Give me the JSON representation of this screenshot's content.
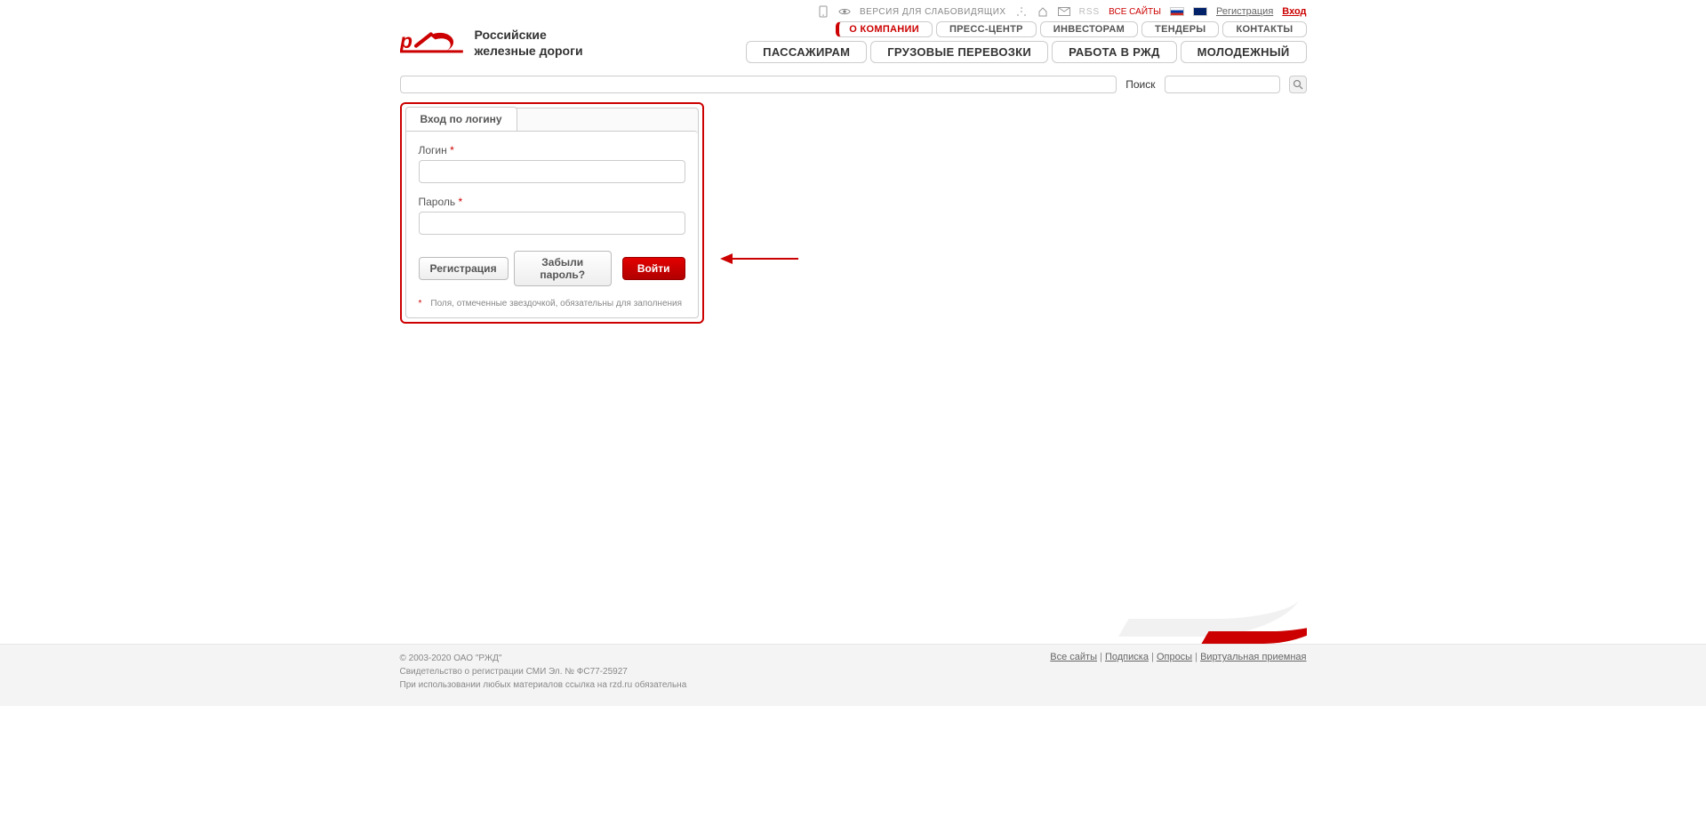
{
  "topbar": {
    "accessibility": "ВЕРСИЯ ДЛЯ СЛАБОВИДЯЩИХ",
    "rss": "RSS",
    "all_sites": "ВСЕ САЙТЫ",
    "register": "Регистрация",
    "login": "Вход"
  },
  "logo": {
    "line1": "Российские",
    "line2": "железные дороги"
  },
  "nav_primary": [
    {
      "label": "О КОМПАНИИ",
      "active": true
    },
    {
      "label": "ПРЕСС-ЦЕНТР",
      "active": false
    },
    {
      "label": "ИНВЕСТОРАМ",
      "active": false
    },
    {
      "label": "ТЕНДЕРЫ",
      "active": false
    },
    {
      "label": "КОНТАКТЫ",
      "active": false
    }
  ],
  "nav_secondary": [
    {
      "label": "ПАССАЖИРАМ"
    },
    {
      "label": "ГРУЗОВЫЕ ПЕРЕВОЗКИ"
    },
    {
      "label": "РАБОТА В РЖД"
    },
    {
      "label": "МОЛОДЕЖНЫЙ"
    }
  ],
  "search": {
    "label": "Поиск"
  },
  "login_form": {
    "tab": "Вход по логину",
    "login_label": "Логин",
    "password_label": "Пароль",
    "register_btn": "Регистрация",
    "forgot_btn": "Забыли пароль?",
    "submit_btn": "Войти",
    "note": "Поля, отмеченные звездочкой, обязательны для заполнения",
    "asterisk": "*"
  },
  "footer": {
    "copyright": "© 2003-2020 ОАО \"РЖД\"",
    "cert": "Свидетельство о регистрации СМИ Эл. № ФС77-25927",
    "usage": "При использовании любых материалов ссылка на rzd.ru обязательна",
    "links": {
      "all_sites": "Все сайты",
      "subscribe": "Подписка",
      "polls": "Опросы",
      "reception": "Виртуальная приемная"
    }
  }
}
